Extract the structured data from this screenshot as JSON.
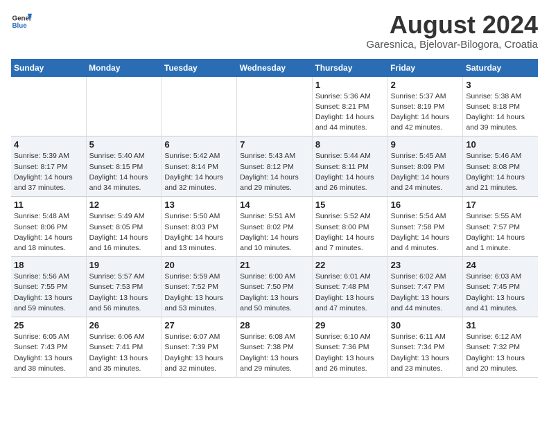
{
  "header": {
    "logo_general": "General",
    "logo_blue": "Blue",
    "title": "August 2024",
    "subtitle": "Garesnica, Bjelovar-Bilogora, Croatia"
  },
  "days_of_week": [
    "Sunday",
    "Monday",
    "Tuesday",
    "Wednesday",
    "Thursday",
    "Friday",
    "Saturday"
  ],
  "weeks": [
    [
      {
        "day": "",
        "info": ""
      },
      {
        "day": "",
        "info": ""
      },
      {
        "day": "",
        "info": ""
      },
      {
        "day": "",
        "info": ""
      },
      {
        "day": "1",
        "info": "Sunrise: 5:36 AM\nSunset: 8:21 PM\nDaylight: 14 hours\nand 44 minutes."
      },
      {
        "day": "2",
        "info": "Sunrise: 5:37 AM\nSunset: 8:19 PM\nDaylight: 14 hours\nand 42 minutes."
      },
      {
        "day": "3",
        "info": "Sunrise: 5:38 AM\nSunset: 8:18 PM\nDaylight: 14 hours\nand 39 minutes."
      }
    ],
    [
      {
        "day": "4",
        "info": "Sunrise: 5:39 AM\nSunset: 8:17 PM\nDaylight: 14 hours\nand 37 minutes."
      },
      {
        "day": "5",
        "info": "Sunrise: 5:40 AM\nSunset: 8:15 PM\nDaylight: 14 hours\nand 34 minutes."
      },
      {
        "day": "6",
        "info": "Sunrise: 5:42 AM\nSunset: 8:14 PM\nDaylight: 14 hours\nand 32 minutes."
      },
      {
        "day": "7",
        "info": "Sunrise: 5:43 AM\nSunset: 8:12 PM\nDaylight: 14 hours\nand 29 minutes."
      },
      {
        "day": "8",
        "info": "Sunrise: 5:44 AM\nSunset: 8:11 PM\nDaylight: 14 hours\nand 26 minutes."
      },
      {
        "day": "9",
        "info": "Sunrise: 5:45 AM\nSunset: 8:09 PM\nDaylight: 14 hours\nand 24 minutes."
      },
      {
        "day": "10",
        "info": "Sunrise: 5:46 AM\nSunset: 8:08 PM\nDaylight: 14 hours\nand 21 minutes."
      }
    ],
    [
      {
        "day": "11",
        "info": "Sunrise: 5:48 AM\nSunset: 8:06 PM\nDaylight: 14 hours\nand 18 minutes."
      },
      {
        "day": "12",
        "info": "Sunrise: 5:49 AM\nSunset: 8:05 PM\nDaylight: 14 hours\nand 16 minutes."
      },
      {
        "day": "13",
        "info": "Sunrise: 5:50 AM\nSunset: 8:03 PM\nDaylight: 14 hours\nand 13 minutes."
      },
      {
        "day": "14",
        "info": "Sunrise: 5:51 AM\nSunset: 8:02 PM\nDaylight: 14 hours\nand 10 minutes."
      },
      {
        "day": "15",
        "info": "Sunrise: 5:52 AM\nSunset: 8:00 PM\nDaylight: 14 hours\nand 7 minutes."
      },
      {
        "day": "16",
        "info": "Sunrise: 5:54 AM\nSunset: 7:58 PM\nDaylight: 14 hours\nand 4 minutes."
      },
      {
        "day": "17",
        "info": "Sunrise: 5:55 AM\nSunset: 7:57 PM\nDaylight: 14 hours\nand 1 minute."
      }
    ],
    [
      {
        "day": "18",
        "info": "Sunrise: 5:56 AM\nSunset: 7:55 PM\nDaylight: 13 hours\nand 59 minutes."
      },
      {
        "day": "19",
        "info": "Sunrise: 5:57 AM\nSunset: 7:53 PM\nDaylight: 13 hours\nand 56 minutes."
      },
      {
        "day": "20",
        "info": "Sunrise: 5:59 AM\nSunset: 7:52 PM\nDaylight: 13 hours\nand 53 minutes."
      },
      {
        "day": "21",
        "info": "Sunrise: 6:00 AM\nSunset: 7:50 PM\nDaylight: 13 hours\nand 50 minutes."
      },
      {
        "day": "22",
        "info": "Sunrise: 6:01 AM\nSunset: 7:48 PM\nDaylight: 13 hours\nand 47 minutes."
      },
      {
        "day": "23",
        "info": "Sunrise: 6:02 AM\nSunset: 7:47 PM\nDaylight: 13 hours\nand 44 minutes."
      },
      {
        "day": "24",
        "info": "Sunrise: 6:03 AM\nSunset: 7:45 PM\nDaylight: 13 hours\nand 41 minutes."
      }
    ],
    [
      {
        "day": "25",
        "info": "Sunrise: 6:05 AM\nSunset: 7:43 PM\nDaylight: 13 hours\nand 38 minutes."
      },
      {
        "day": "26",
        "info": "Sunrise: 6:06 AM\nSunset: 7:41 PM\nDaylight: 13 hours\nand 35 minutes."
      },
      {
        "day": "27",
        "info": "Sunrise: 6:07 AM\nSunset: 7:39 PM\nDaylight: 13 hours\nand 32 minutes."
      },
      {
        "day": "28",
        "info": "Sunrise: 6:08 AM\nSunset: 7:38 PM\nDaylight: 13 hours\nand 29 minutes."
      },
      {
        "day": "29",
        "info": "Sunrise: 6:10 AM\nSunset: 7:36 PM\nDaylight: 13 hours\nand 26 minutes."
      },
      {
        "day": "30",
        "info": "Sunrise: 6:11 AM\nSunset: 7:34 PM\nDaylight: 13 hours\nand 23 minutes."
      },
      {
        "day": "31",
        "info": "Sunrise: 6:12 AM\nSunset: 7:32 PM\nDaylight: 13 hours\nand 20 minutes."
      }
    ]
  ]
}
